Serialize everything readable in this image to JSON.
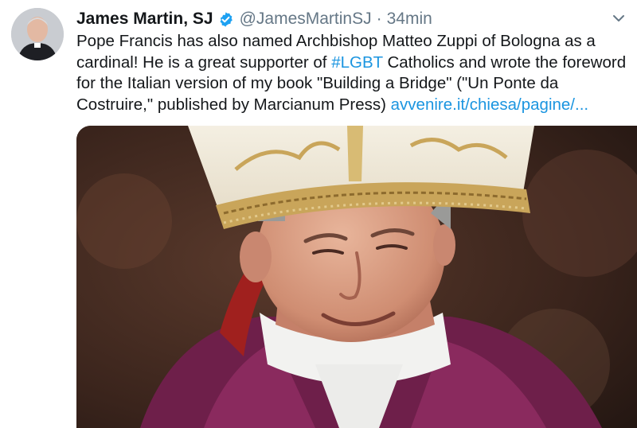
{
  "tweet": {
    "author_name": "James Martin, SJ",
    "handle": "@JamesMartinSJ",
    "separator": "·",
    "time": "34min",
    "text_part1": "Pope Francis has also named Archbishop Matteo Zuppi of Bologna as a cardinal! He is a great supporter of ",
    "hashtag": "#LGBT",
    "text_part2": " Catholics and wrote the foreword for the Italian version of my book \"Building a Bridge\" (\"Un Ponte da Costruire,\" published by Marcianum Press) ",
    "link": "avvenire.it/chiesa/pagine/...",
    "icons": {
      "verified": "verified-badge-icon",
      "menu": "chevron-down-icon"
    },
    "colors": {
      "link": "#1b95e0",
      "verified": "#1da1f2",
      "secondary_text": "#657786"
    }
  }
}
